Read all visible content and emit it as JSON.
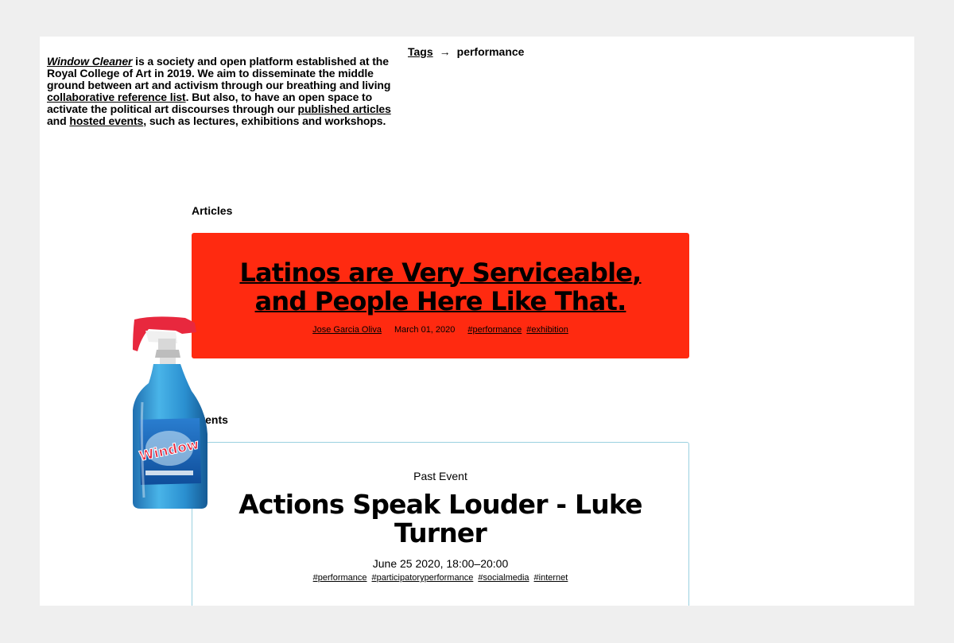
{
  "intro": {
    "brand": "Window Cleaner",
    "text1": " is a society and open platform established at the Royal College of Art in 2019. We aim to disseminate the middle ground between art and activism through our breathing and living ",
    "link_reference": "collaborative reference list",
    "text2": ". But also, to have an open space to activate the political art discourses through our ",
    "link_articles": "published articles",
    "text3": " and ",
    "link_events": "hosted events",
    "text4": ", such as lectures, exhibitions and workshops."
  },
  "breadcrumb": {
    "root": "Tags",
    "arrow": "→",
    "current": "performance"
  },
  "articles": {
    "heading": "Articles",
    "items": [
      {
        "title": "Latinos are Very Serviceable, and People Here Like That.",
        "author": "Jose Garcia Oliva",
        "date": "March 01, 2020",
        "tags": [
          "#performance",
          "#exhibition"
        ],
        "color": "#ff2a10"
      }
    ]
  },
  "events": {
    "heading": "Events",
    "items": [
      {
        "status": "Past Event",
        "title": "Actions Speak Louder - Luke Turner",
        "date": "June 25 2020, 18:00–20:00",
        "tags": [
          "#performance",
          "#participatoryperformance",
          "#socialmedia",
          "#internet"
        ]
      }
    ]
  },
  "mascot": {
    "label": "Window",
    "icon": "window-cleaner-bottle"
  }
}
